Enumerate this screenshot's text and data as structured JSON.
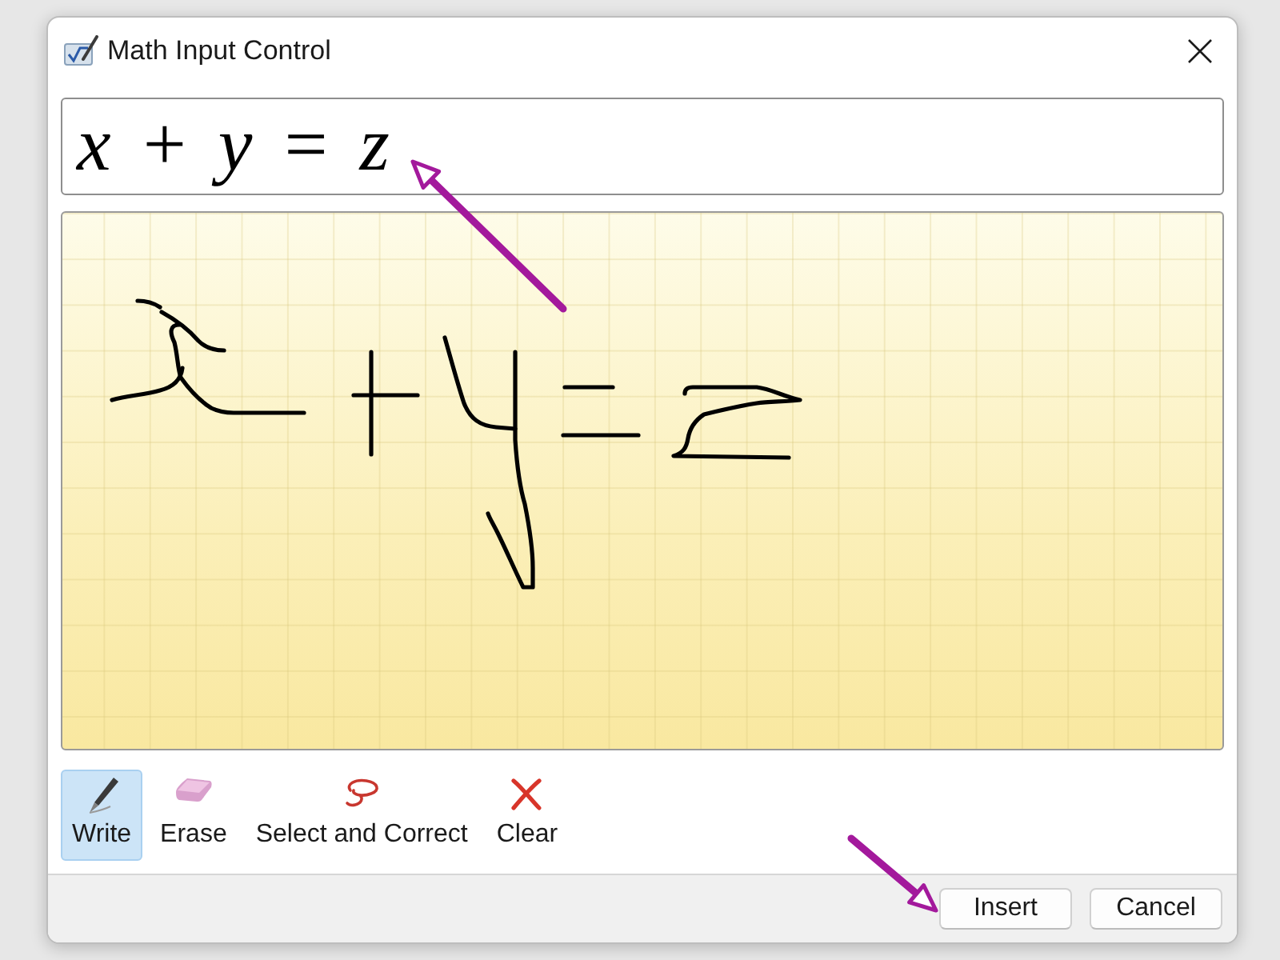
{
  "window": {
    "title": "Math Input Control"
  },
  "preview": {
    "expression": "*x* + *y* = *z*"
  },
  "tools": [
    {
      "label": "Write",
      "kind": "pen",
      "selected": true
    },
    {
      "label": "Erase",
      "kind": "eraser",
      "selected": false
    },
    {
      "label": "Select and Correct",
      "kind": "lasso",
      "selected": false
    },
    {
      "label": "Clear",
      "kind": "clear",
      "selected": false
    }
  ],
  "buttons": [
    "Insert",
    "Cancel"
  ]
}
